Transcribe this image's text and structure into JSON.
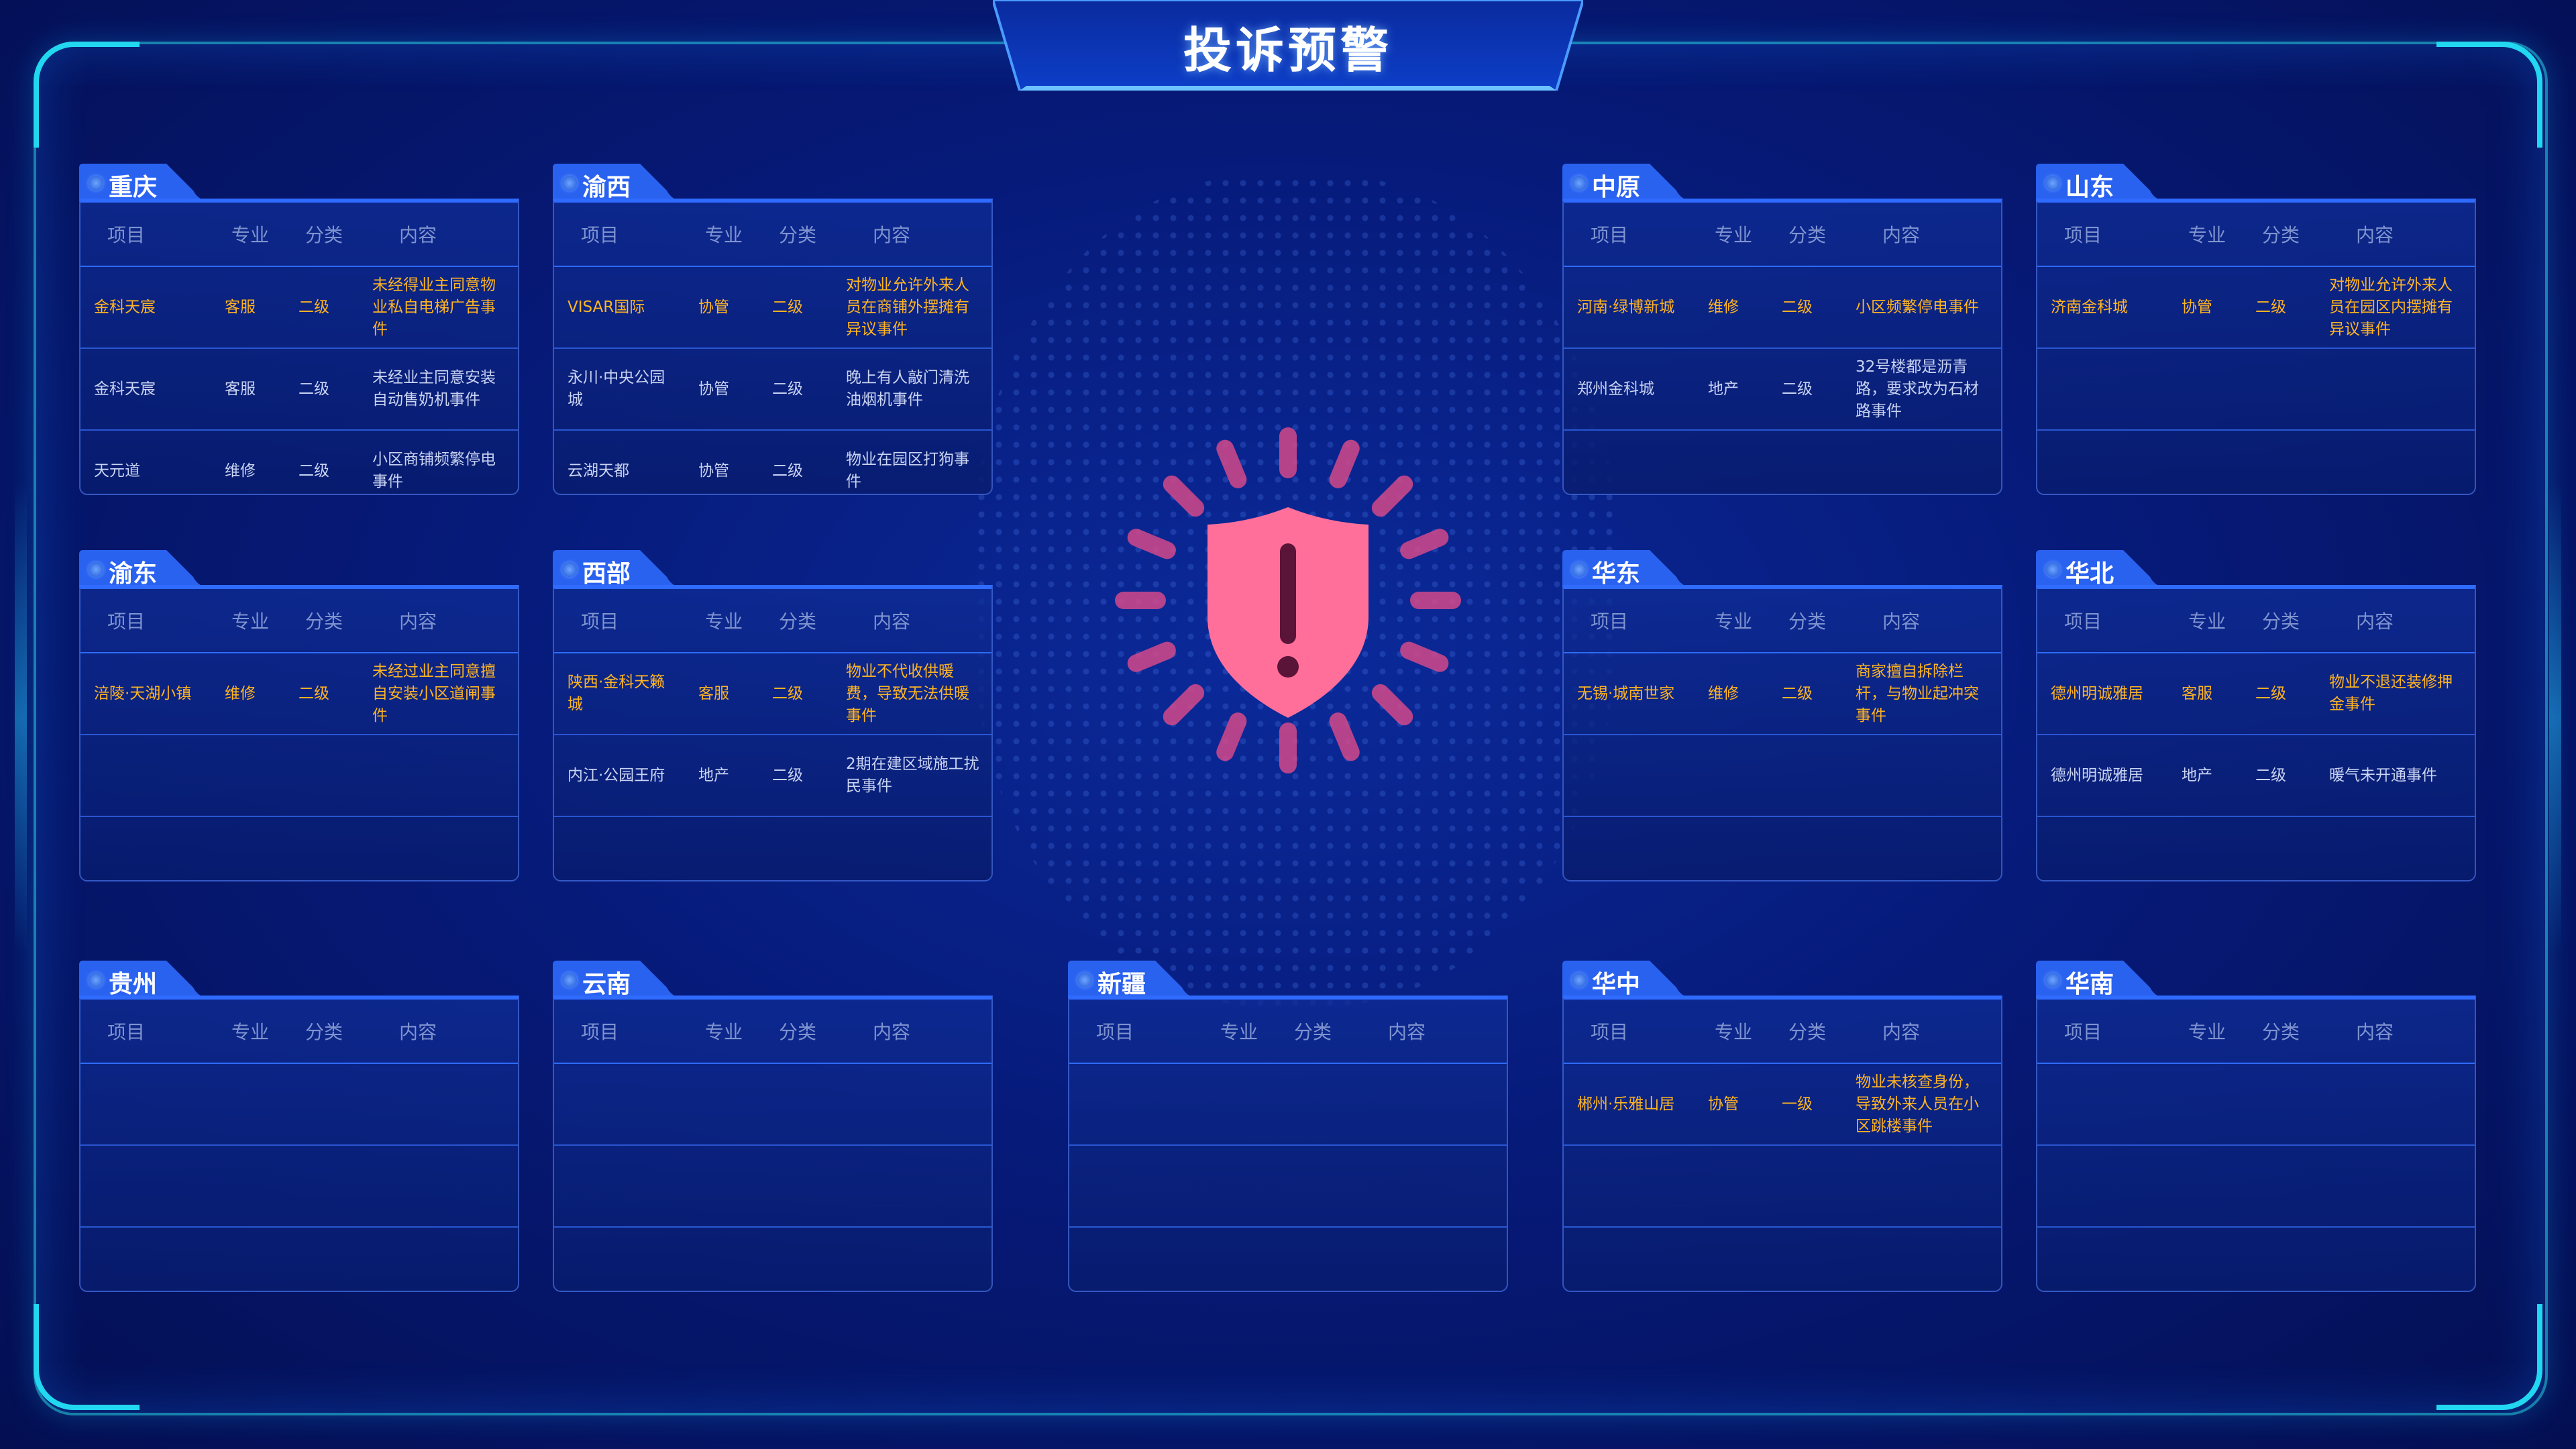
{
  "page": {
    "title": "投诉预警"
  },
  "columns": {
    "project": "项目",
    "major": "专业",
    "category": "分类",
    "content": "内容"
  },
  "colors": {
    "highlight": "#ffb422",
    "normal": "#c9d3f2",
    "shield": "#ff6f9a",
    "accent": "#2f6bff"
  },
  "regions": [
    {
      "name": "重庆",
      "rows": [
        {
          "project": "金科天宸",
          "major": "客服",
          "category": "二级",
          "content": "未经得业主同意物业私自电梯广告事件",
          "highlight": true
        },
        {
          "project": "金科天宸",
          "major": "客服",
          "category": "二级",
          "content": "未经业主同意安装自动售奶机事件",
          "highlight": false
        },
        {
          "project": "天元道",
          "major": "维修",
          "category": "二级",
          "content": "小区商铺频繁停电事件",
          "highlight": false
        }
      ]
    },
    {
      "name": "渝西",
      "rows": [
        {
          "project": "VISAR国际",
          "major": "协管",
          "category": "二级",
          "content": "对物业允许外来人员在商铺外摆摊有异议事件",
          "highlight": true
        },
        {
          "project": "永川·中央公园城",
          "major": "协管",
          "category": "二级",
          "content": "晚上有人敲门清洗油烟机事件",
          "highlight": false
        },
        {
          "project": "云湖天都",
          "major": "协管",
          "category": "二级",
          "content": "物业在园区打狗事件",
          "highlight": false
        }
      ]
    },
    {
      "name": "中原",
      "rows": [
        {
          "project": "河南·绿博新城",
          "major": "维修",
          "category": "二级",
          "content": "小区频繁停电事件",
          "highlight": true
        },
        {
          "project": "郑州金科城",
          "major": "地产",
          "category": "二级",
          "content": "32号楼都是沥青路，要求改为石材路事件",
          "highlight": false
        },
        {
          "project": "",
          "major": "",
          "category": "",
          "content": "",
          "highlight": false
        }
      ]
    },
    {
      "name": "山东",
      "rows": [
        {
          "project": "济南金科城",
          "major": "协管",
          "category": "二级",
          "content": "对物业允许外来人员在园区内摆摊有异议事件",
          "highlight": true
        },
        {
          "project": "",
          "major": "",
          "category": "",
          "content": "",
          "highlight": false
        },
        {
          "project": "",
          "major": "",
          "category": "",
          "content": "",
          "highlight": false
        }
      ]
    },
    {
      "name": "渝东",
      "rows": [
        {
          "project": "涪陵·天湖小镇",
          "major": "维修",
          "category": "二级",
          "content": "未经过业主同意擅自安装小区道闸事件",
          "highlight": true
        },
        {
          "project": "",
          "major": "",
          "category": "",
          "content": "",
          "highlight": false
        },
        {
          "project": "",
          "major": "",
          "category": "",
          "content": "",
          "highlight": false
        }
      ]
    },
    {
      "name": "西部",
      "rows": [
        {
          "project": "陕西·金科天籁城",
          "major": "客服",
          "category": "二级",
          "content": "物业不代收供暖费，导致无法供暖事件",
          "highlight": true
        },
        {
          "project": "内江·公园王府",
          "major": "地产",
          "category": "二级",
          "content": "2期在建区域施工扰民事件",
          "highlight": false
        },
        {
          "project": "",
          "major": "",
          "category": "",
          "content": "",
          "highlight": false
        }
      ]
    },
    {
      "name": "华东",
      "rows": [
        {
          "project": "无锡·城南世家",
          "major": "维修",
          "category": "二级",
          "content": "商家擅自拆除栏杆，与物业起冲突事件",
          "highlight": true
        },
        {
          "project": "",
          "major": "",
          "category": "",
          "content": "",
          "highlight": false
        },
        {
          "project": "",
          "major": "",
          "category": "",
          "content": "",
          "highlight": false
        }
      ]
    },
    {
      "name": "华北",
      "rows": [
        {
          "project": "德州明诚雅居",
          "major": "客服",
          "category": "二级",
          "content": "物业不退还装修押金事件",
          "highlight": true
        },
        {
          "project": "德州明诚雅居",
          "major": "地产",
          "category": "二级",
          "content": "暖气未开通事件",
          "highlight": false
        },
        {
          "project": "",
          "major": "",
          "category": "",
          "content": "",
          "highlight": false
        }
      ]
    },
    {
      "name": "贵州",
      "rows": [
        {
          "project": "",
          "major": "",
          "category": "",
          "content": "",
          "highlight": false
        },
        {
          "project": "",
          "major": "",
          "category": "",
          "content": "",
          "highlight": false
        },
        {
          "project": "",
          "major": "",
          "category": "",
          "content": "",
          "highlight": false
        }
      ]
    },
    {
      "name": "云南",
      "rows": [
        {
          "project": "",
          "major": "",
          "category": "",
          "content": "",
          "highlight": false
        },
        {
          "project": "",
          "major": "",
          "category": "",
          "content": "",
          "highlight": false
        },
        {
          "project": "",
          "major": "",
          "category": "",
          "content": "",
          "highlight": false
        }
      ]
    },
    {
      "name": "新疆",
      "rows": [
        {
          "project": "",
          "major": "",
          "category": "",
          "content": "",
          "highlight": false
        },
        {
          "project": "",
          "major": "",
          "category": "",
          "content": "",
          "highlight": false
        },
        {
          "project": "",
          "major": "",
          "category": "",
          "content": "",
          "highlight": false
        }
      ]
    },
    {
      "name": "华中",
      "rows": [
        {
          "project": "郴州·乐雅山居",
          "major": "协管",
          "category": "一级",
          "content": "物业未核查身份，导致外来人员在小区跳楼事件",
          "highlight": true
        },
        {
          "project": "",
          "major": "",
          "category": "",
          "content": "",
          "highlight": false
        },
        {
          "project": "",
          "major": "",
          "category": "",
          "content": "",
          "highlight": false
        }
      ]
    },
    {
      "name": "华南",
      "rows": [
        {
          "project": "",
          "major": "",
          "category": "",
          "content": "",
          "highlight": false
        },
        {
          "project": "",
          "major": "",
          "category": "",
          "content": "",
          "highlight": false
        },
        {
          "project": "",
          "major": "",
          "category": "",
          "content": "",
          "highlight": false
        }
      ]
    }
  ]
}
